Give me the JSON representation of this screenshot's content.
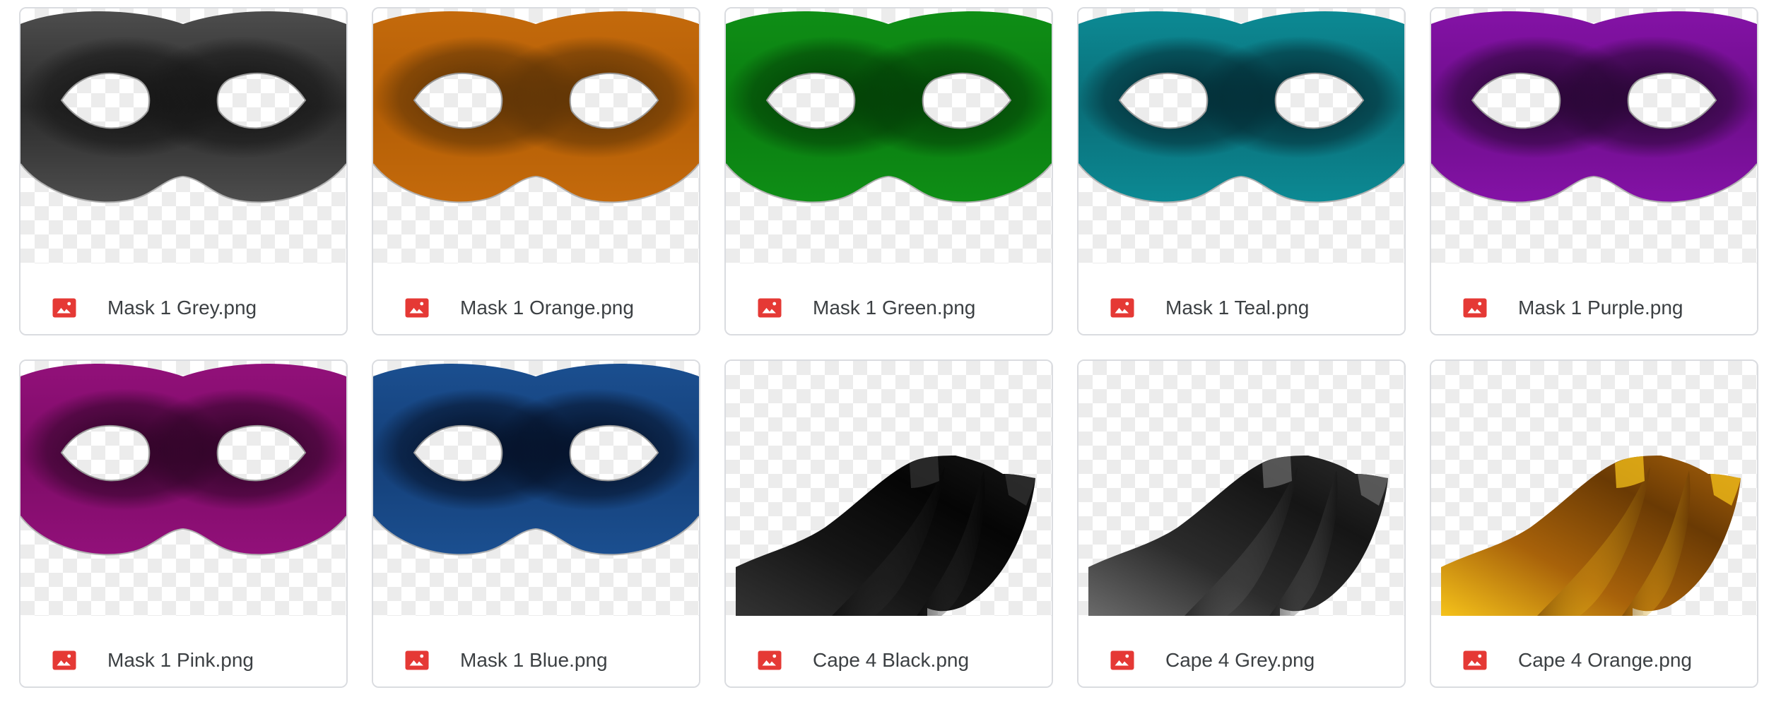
{
  "files": [
    {
      "name": "Mask 1 Grey.png",
      "kind": "mask",
      "icon": "image-file-icon",
      "colors": {
        "base": "#2b2b2b",
        "light": "#4d4d4d",
        "dark": "#161616"
      }
    },
    {
      "name": "Mask 1 Orange.png",
      "kind": "mask",
      "icon": "image-file-icon",
      "colors": {
        "base": "#b35e05",
        "light": "#c46a0c",
        "dark": "#5a3206"
      }
    },
    {
      "name": "Mask 1 Green.png",
      "kind": "mask",
      "icon": "image-file-icon",
      "colors": {
        "base": "#0a7d10",
        "light": "#0f8e16",
        "dark": "#033d06"
      }
    },
    {
      "name": "Mask 1 Teal.png",
      "kind": "mask",
      "icon": "image-file-icon",
      "colors": {
        "base": "#0a6e78",
        "light": "#0c8a94",
        "dark": "#032a33"
      }
    },
    {
      "name": "Mask 1 Purple.png",
      "kind": "mask",
      "icon": "image-file-icon",
      "colors": {
        "base": "#6d0e8a",
        "light": "#8412a6",
        "dark": "#250630"
      }
    },
    {
      "name": "Mask 1 Pink.png",
      "kind": "mask",
      "icon": "image-file-icon",
      "colors": {
        "base": "#7d0c66",
        "light": "#92107a",
        "dark": "#2c0424"
      }
    },
    {
      "name": "Mask 1 Blue.png",
      "kind": "mask",
      "icon": "image-file-icon",
      "colors": {
        "base": "#143f78",
        "light": "#1b4f90",
        "dark": "#040f24"
      }
    },
    {
      "name": "Cape 4 Black.png",
      "kind": "cape",
      "icon": "image-file-icon",
      "colors": {
        "base": "#161616",
        "light": "#333333",
        "dark": "#050505"
      }
    },
    {
      "name": "Cape 4 Grey.png",
      "kind": "cape",
      "icon": "image-file-icon",
      "colors": {
        "base": "#2c2c2c",
        "light": "#6a6a6a",
        "dark": "#151515"
      }
    },
    {
      "name": "Cape 4 Orange.png",
      "kind": "cape",
      "icon": "image-file-icon",
      "colors": {
        "base": "#a8620a",
        "light": "#f5c21a",
        "dark": "#6a3a04"
      }
    }
  ],
  "icon_color": "#e53935"
}
